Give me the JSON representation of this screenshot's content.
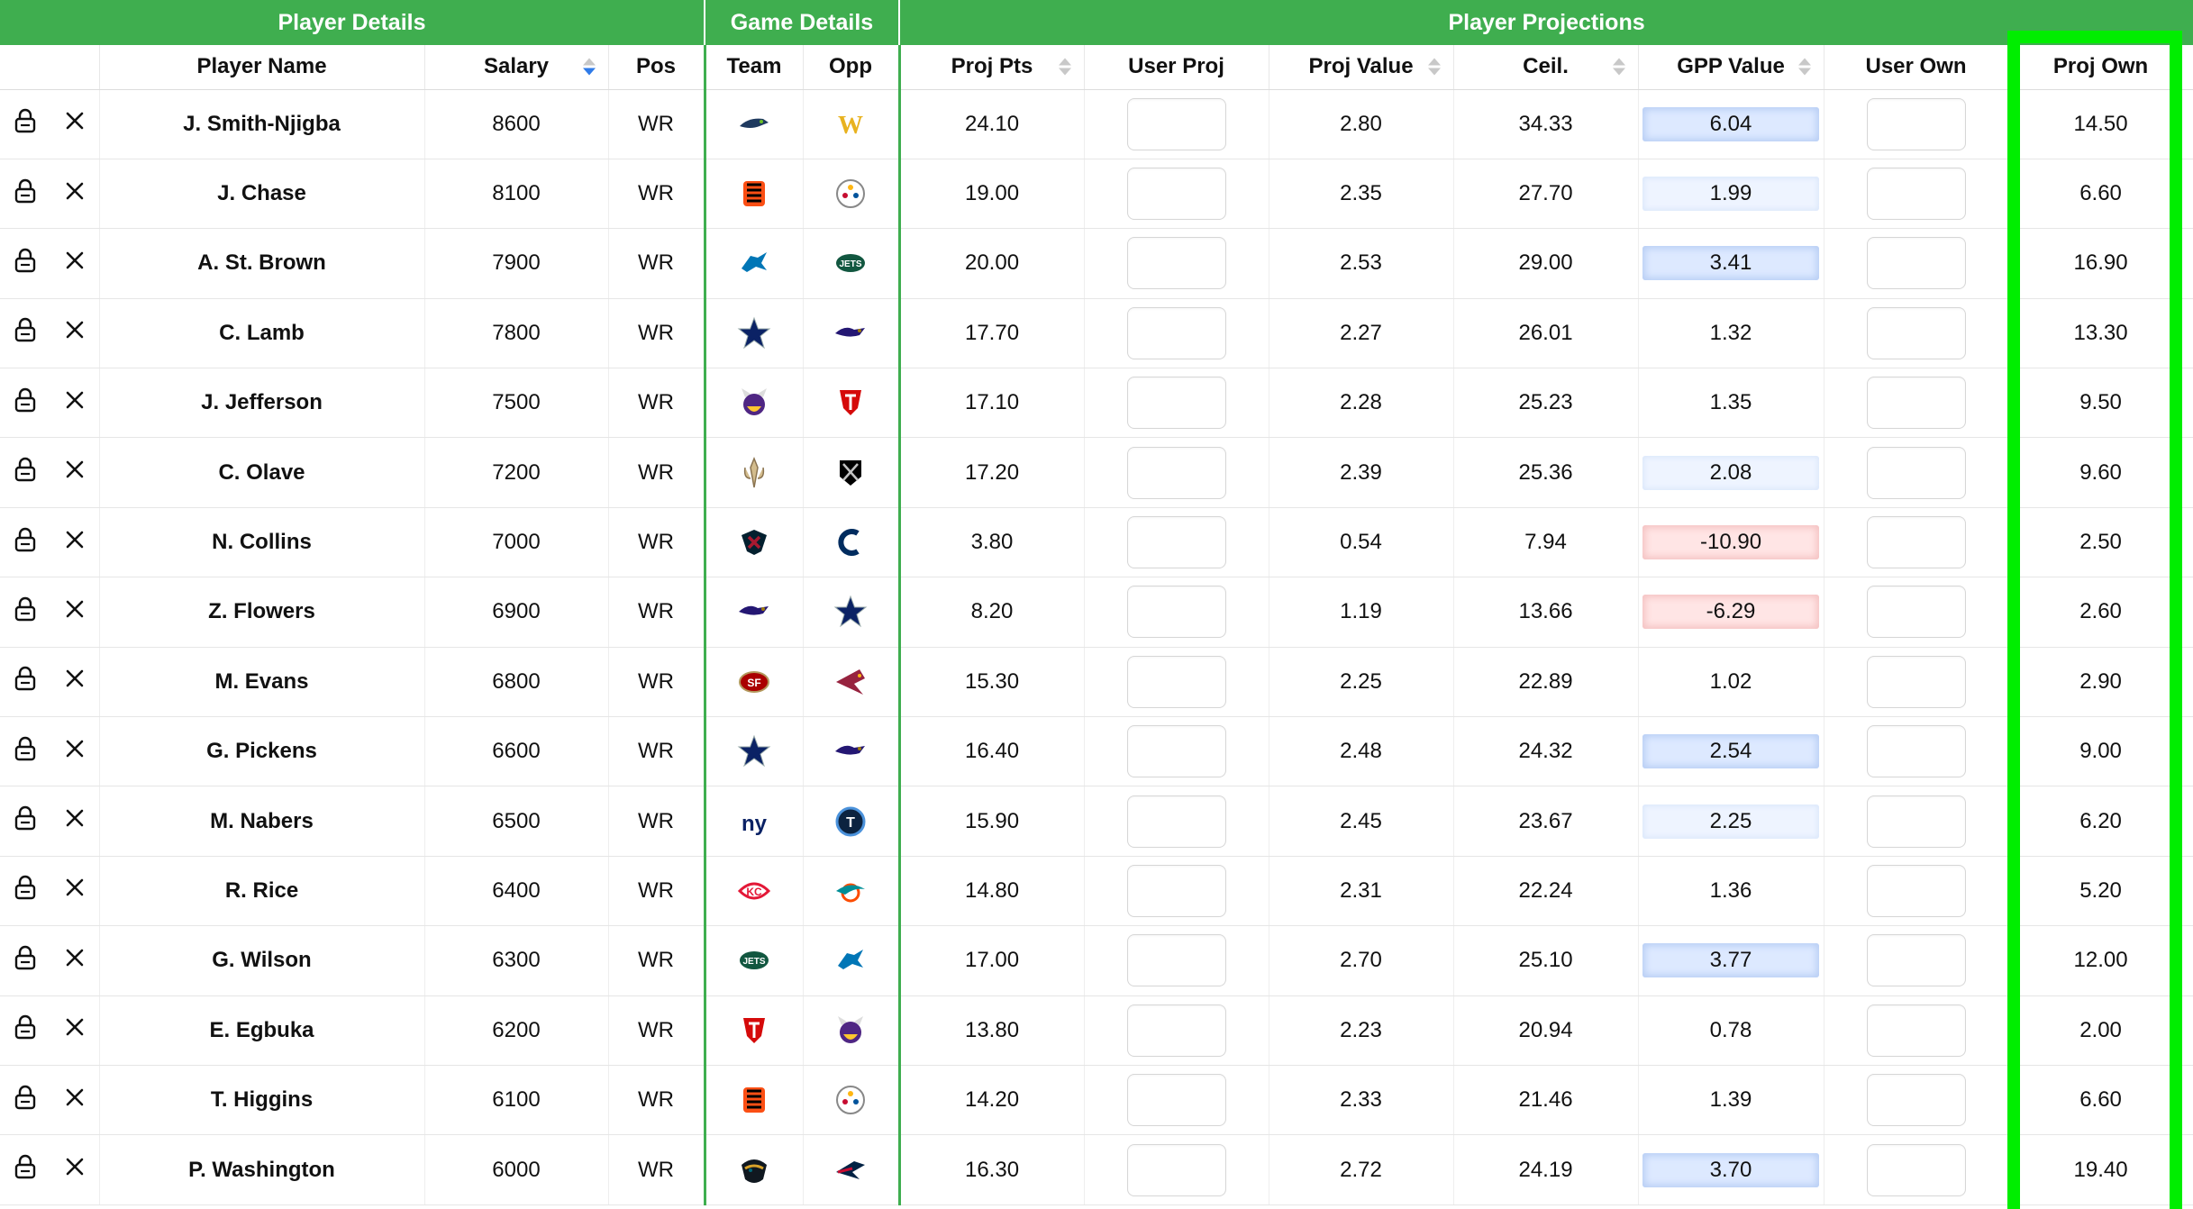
{
  "groups": {
    "player_details": "Player Details",
    "game_details": "Game Details",
    "player_projections": "Player Projections"
  },
  "columns": {
    "player_name": "Player Name",
    "salary": "Salary",
    "pos": "Pos",
    "team": "Team",
    "opp": "Opp",
    "proj_pts": "Proj Pts",
    "user_proj": "User Proj",
    "proj_value": "Proj Value",
    "ceil": "Ceil.",
    "gpp_value": "GPP Value",
    "user_own": "User Own",
    "proj_own": "Proj Own"
  },
  "sort": {
    "column": "salary",
    "direction": "descending"
  },
  "colors": {
    "accent": "#3fae4f",
    "highlight": "#00ee00",
    "sort_active": "#2f7be8"
  },
  "icons": {
    "lock": "lock-icon",
    "remove": "close-icon"
  },
  "rows": [
    {
      "name": "J. Smith-Njigba",
      "salary": "8600",
      "pos": "WR",
      "team": "SEA",
      "opp": "WAS",
      "proj_pts": "24.10",
      "proj_value": "2.80",
      "ceil": "34.33",
      "gpp_value": "6.04",
      "gpp_tone": "strong",
      "proj_own": "14.50"
    },
    {
      "name": "J. Chase",
      "salary": "8100",
      "pos": "WR",
      "team": "CIN",
      "opp": "PIT",
      "proj_pts": "19.00",
      "proj_value": "2.35",
      "ceil": "27.70",
      "gpp_value": "1.99",
      "gpp_tone": "weak",
      "proj_own": "6.60"
    },
    {
      "name": "A. St. Brown",
      "salary": "7900",
      "pos": "WR",
      "team": "DET",
      "opp": "NYJ",
      "proj_pts": "20.00",
      "proj_value": "2.53",
      "ceil": "29.00",
      "gpp_value": "3.41",
      "gpp_tone": "strong",
      "proj_own": "16.90"
    },
    {
      "name": "C. Lamb",
      "salary": "7800",
      "pos": "WR",
      "team": "DAL",
      "opp": "BAL",
      "proj_pts": "17.70",
      "proj_value": "2.27",
      "ceil": "26.01",
      "gpp_value": "1.32",
      "gpp_tone": "none",
      "proj_own": "13.30"
    },
    {
      "name": "J. Jefferson",
      "salary": "7500",
      "pos": "WR",
      "team": "MIN",
      "opp": "TB",
      "proj_pts": "17.10",
      "proj_value": "2.28",
      "ceil": "25.23",
      "gpp_value": "1.35",
      "gpp_tone": "none",
      "proj_own": "9.50"
    },
    {
      "name": "C. Olave",
      "salary": "7200",
      "pos": "WR",
      "team": "NO",
      "opp": "LV",
      "proj_pts": "17.20",
      "proj_value": "2.39",
      "ceil": "25.36",
      "gpp_value": "2.08",
      "gpp_tone": "weak",
      "proj_own": "9.60"
    },
    {
      "name": "N. Collins",
      "salary": "7000",
      "pos": "WR",
      "team": "HOU",
      "opp": "IND",
      "proj_pts": "3.80",
      "proj_value": "0.54",
      "ceil": "7.94",
      "gpp_value": "-10.90",
      "gpp_tone": "neg",
      "proj_own": "2.50"
    },
    {
      "name": "Z. Flowers",
      "salary": "6900",
      "pos": "WR",
      "team": "BAL",
      "opp": "DAL",
      "proj_pts": "8.20",
      "proj_value": "1.19",
      "ceil": "13.66",
      "gpp_value": "-6.29",
      "gpp_tone": "neg",
      "proj_own": "2.60"
    },
    {
      "name": "M. Evans",
      "salary": "6800",
      "pos": "WR",
      "team": "SF",
      "opp": "ARI",
      "proj_pts": "15.30",
      "proj_value": "2.25",
      "ceil": "22.89",
      "gpp_value": "1.02",
      "gpp_tone": "none",
      "proj_own": "2.90"
    },
    {
      "name": "G. Pickens",
      "salary": "6600",
      "pos": "WR",
      "team": "DAL",
      "opp": "BAL",
      "proj_pts": "16.40",
      "proj_value": "2.48",
      "ceil": "24.32",
      "gpp_value": "2.54",
      "gpp_tone": "strong",
      "proj_own": "9.00"
    },
    {
      "name": "M. Nabers",
      "salary": "6500",
      "pos": "WR",
      "team": "NYG",
      "opp": "TEN",
      "proj_pts": "15.90",
      "proj_value": "2.45",
      "ceil": "23.67",
      "gpp_value": "2.25",
      "gpp_tone": "weak",
      "proj_own": "6.20"
    },
    {
      "name": "R. Rice",
      "salary": "6400",
      "pos": "WR",
      "team": "KC",
      "opp": "MIA",
      "proj_pts": "14.80",
      "proj_value": "2.31",
      "ceil": "22.24",
      "gpp_value": "1.36",
      "gpp_tone": "none",
      "proj_own": "5.20"
    },
    {
      "name": "G. Wilson",
      "salary": "6300",
      "pos": "WR",
      "team": "NYJ",
      "opp": "DET",
      "proj_pts": "17.00",
      "proj_value": "2.70",
      "ceil": "25.10",
      "gpp_value": "3.77",
      "gpp_tone": "strong",
      "proj_own": "12.00"
    },
    {
      "name": "E. Egbuka",
      "salary": "6200",
      "pos": "WR",
      "team": "TB",
      "opp": "MIN",
      "proj_pts": "13.80",
      "proj_value": "2.23",
      "ceil": "20.94",
      "gpp_value": "0.78",
      "gpp_tone": "none",
      "proj_own": "2.00"
    },
    {
      "name": "T. Higgins",
      "salary": "6100",
      "pos": "WR",
      "team": "CIN",
      "opp": "PIT",
      "proj_pts": "14.20",
      "proj_value": "2.33",
      "ceil": "21.46",
      "gpp_value": "1.39",
      "gpp_tone": "none",
      "proj_own": "6.60"
    },
    {
      "name": "P. Washington",
      "salary": "6000",
      "pos": "WR",
      "team": "JAX",
      "opp": "NE",
      "proj_pts": "16.30",
      "proj_value": "2.72",
      "ceil": "24.19",
      "gpp_value": "3.70",
      "gpp_tone": "strong",
      "proj_own": "19.40"
    }
  ]
}
